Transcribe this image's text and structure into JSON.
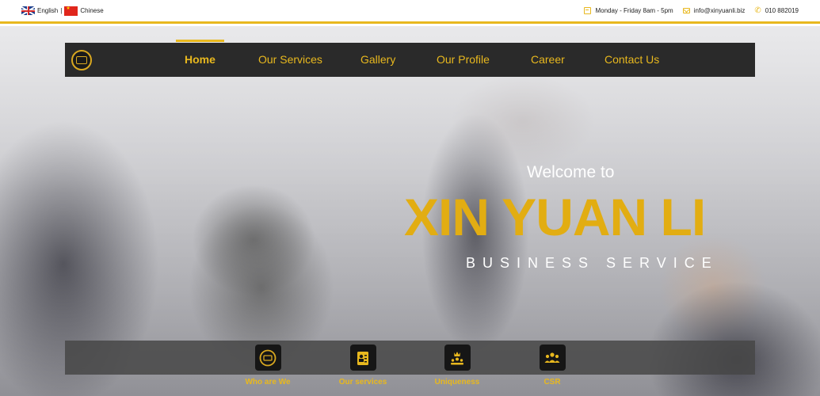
{
  "topbar": {
    "lang_english": "English",
    "lang_sep": "|",
    "lang_chinese": "Chinese",
    "hours": "Monday - Friday 8am - 5pm",
    "email": "info@xinyuanli.biz",
    "phone": "010 882019"
  },
  "nav": {
    "items": [
      {
        "label": "Home"
      },
      {
        "label": "Our Services"
      },
      {
        "label": "Gallery"
      },
      {
        "label": "Our Profile"
      },
      {
        "label": "Career"
      },
      {
        "label": "Contact Us"
      }
    ],
    "active": "Home"
  },
  "hero": {
    "welcome": "Welcome to",
    "brand": "XIN YUAN LI",
    "subtitle": "BUSINESS SERVICE"
  },
  "features": [
    {
      "label": "Who are We",
      "icon": "logo-icon"
    },
    {
      "label": "Our services",
      "icon": "document-user-icon"
    },
    {
      "label": "Uniqueness",
      "icon": "crown-team-icon"
    },
    {
      "label": "CSR",
      "icon": "community-icon"
    }
  ],
  "colors": {
    "accent": "#e8b81e",
    "nav_bg": "#2a2a2a",
    "brand": "#e2ad12"
  }
}
